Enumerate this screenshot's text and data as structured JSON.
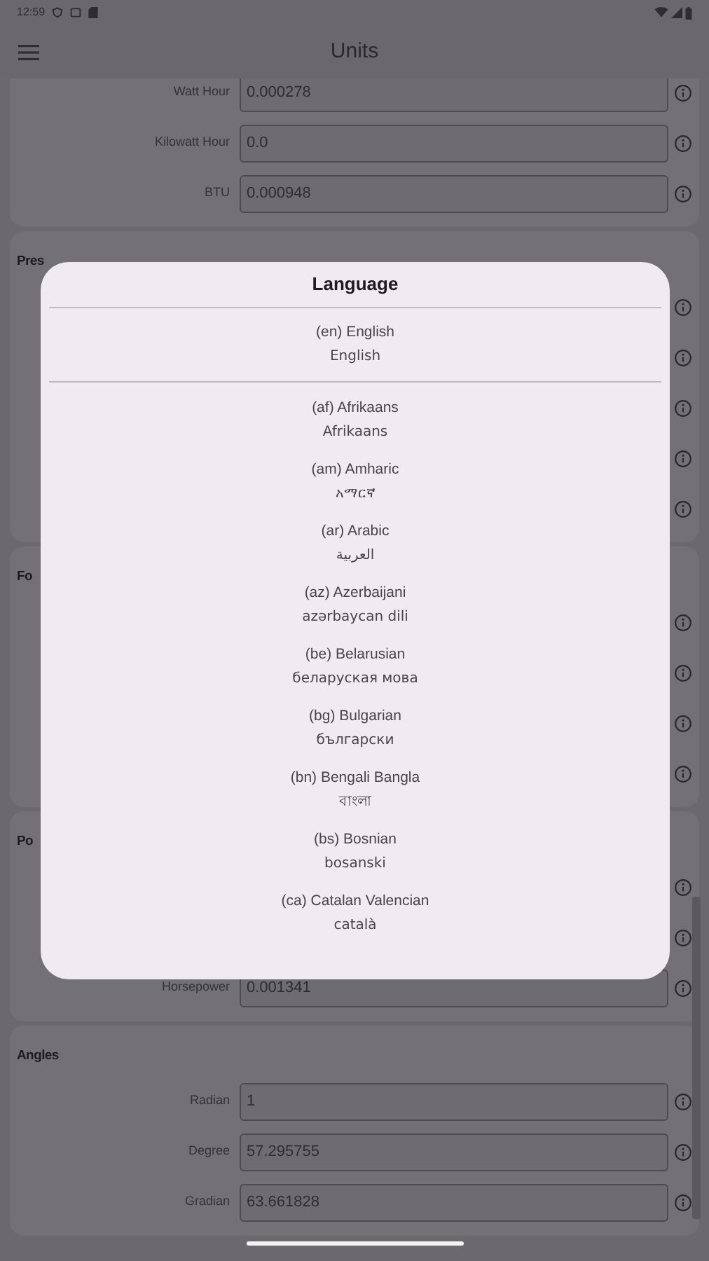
{
  "status_bar": {
    "time": "12:59"
  },
  "app_bar": {
    "title": "Units"
  },
  "sections": [
    {
      "rows": [
        {
          "kind": "field",
          "label": "Watt Hour",
          "value": "0.000278"
        },
        {
          "kind": "field",
          "label": "Kilowatt Hour",
          "value": "0.0"
        },
        {
          "kind": "field",
          "label": "BTU",
          "value": "0.000948"
        }
      ]
    },
    {
      "heading": "Pres",
      "rows": [
        {
          "kind": "covered"
        },
        {
          "kind": "covered"
        },
        {
          "kind": "covered"
        },
        {
          "kind": "covered"
        },
        {
          "kind": "covered"
        }
      ]
    },
    {
      "heading": "Fo",
      "rows": [
        {
          "kind": "covered"
        },
        {
          "kind": "covered"
        },
        {
          "kind": "covered"
        },
        {
          "kind": "covered"
        }
      ]
    },
    {
      "heading": "Po",
      "rows": [
        {
          "kind": "covered"
        },
        {
          "kind": "covered"
        },
        {
          "kind": "field",
          "label": "Horsepower",
          "value": "0.001341"
        }
      ]
    },
    {
      "heading": "Angles",
      "rows": [
        {
          "kind": "field",
          "label": "Radian",
          "value": "1"
        },
        {
          "kind": "field",
          "label": "Degree",
          "value": "57.295755"
        },
        {
          "kind": "field",
          "label": "Gradian",
          "value": "63.661828"
        }
      ]
    }
  ],
  "dialog": {
    "title": "Language",
    "current": {
      "code_name": "(en) English",
      "native": "English"
    },
    "languages": [
      {
        "code_name": "(af) Afrikaans",
        "native": "Afrikaans"
      },
      {
        "code_name": "(am) Amharic",
        "native": "አማርኛ"
      },
      {
        "code_name": "(ar) Arabic",
        "native": "العربية"
      },
      {
        "code_name": "(az) Azerbaijani",
        "native": "azərbaycan dili"
      },
      {
        "code_name": "(be) Belarusian",
        "native": "беларуская мова"
      },
      {
        "code_name": "(bg) Bulgarian",
        "native": "български"
      },
      {
        "code_name": "(bn) Bengali Bangla",
        "native": "বাংলা"
      },
      {
        "code_name": "(bs) Bosnian",
        "native": "bosanski"
      },
      {
        "code_name": "(ca) Catalan Valencian",
        "native": "català"
      }
    ]
  }
}
